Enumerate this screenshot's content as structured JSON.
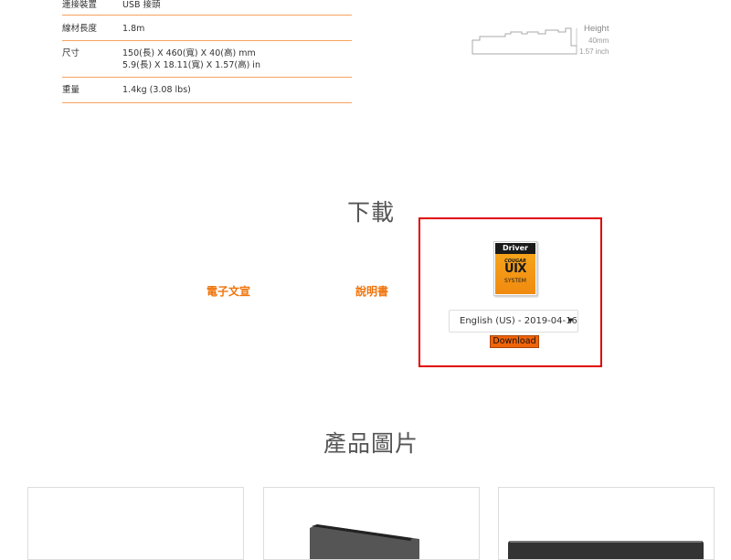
{
  "specs": [
    {
      "key": "連接裝置",
      "lines": [
        "USB 接頭"
      ]
    },
    {
      "key": "線材長度",
      "lines": [
        "1.8m"
      ]
    },
    {
      "key": "尺寸",
      "lines": [
        "150(長) X 460(寬) X 40(高) mm",
        "5.9(長) X 18.11(寬) X 1.57(高) in"
      ]
    },
    {
      "key": "重量",
      "lines": [
        "1.4kg (3.08 lbs)"
      ]
    }
  ],
  "keyboard_diagram": {
    "height_label": "Height",
    "mm": "40mm",
    "inch": "1.57 inch"
  },
  "download": {
    "title": "下載",
    "links": [
      "電子文宣",
      "說明書"
    ],
    "driver": {
      "logo_top": "Driver",
      "logo_brand": "COUGAR",
      "logo_uix": "UIX",
      "logo_system": "SYSTEM",
      "selected_option": "English (US) - 2019-04-16",
      "button_label": "Download"
    }
  },
  "gallery": {
    "title": "產品圖片"
  },
  "colors": {
    "accent": "#f0730a",
    "highlight_border": "#e00000",
    "button_bg": "#f0640a"
  }
}
